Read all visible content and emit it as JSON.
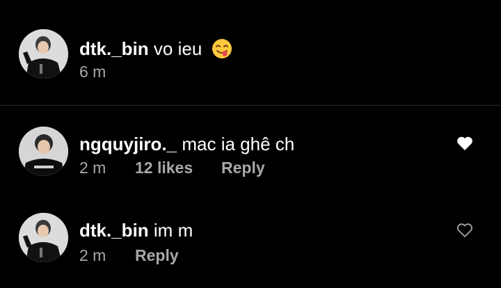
{
  "comments": [
    {
      "username": "dtk._bin",
      "text": "vo ieu",
      "emoji_icon": "face-savoring-food-emoji",
      "time": "6 m",
      "likes": "",
      "reply_label": ""
    },
    {
      "username": "ngquyjiro._",
      "text": "mac ia ghê ch",
      "time": "2 m",
      "likes": "12 likes",
      "reply_label": "Reply",
      "liked": true
    },
    {
      "username": "dtk._bin",
      "text": "im m",
      "time": "2 m",
      "likes": "",
      "reply_label": "Reply",
      "liked": false
    }
  ],
  "colors": {
    "background": "#000000",
    "text_primary": "#ffffff",
    "text_secondary": "#a8a8a8",
    "heart_filled": "#ffffff",
    "heart_outline": "#a8a8a8",
    "divider": "#2a2a2a"
  }
}
